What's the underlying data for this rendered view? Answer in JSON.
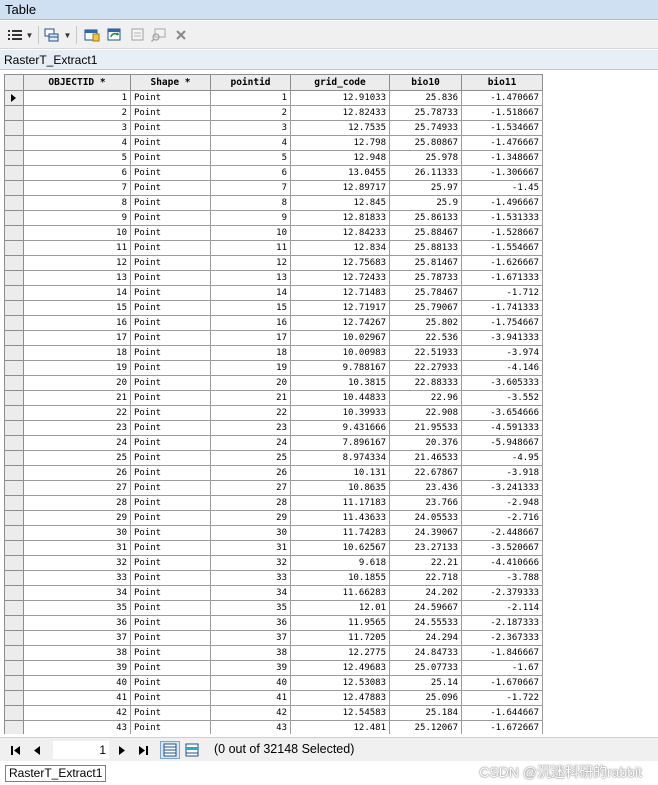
{
  "window": {
    "title": "Table"
  },
  "table_tab": "RasterT_Extract1",
  "columns": [
    "OBJECTID *",
    "Shape *",
    "pointid",
    "grid_code",
    "bio10",
    "bio11"
  ],
  "rows": [
    [
      "1",
      "Point",
      "1",
      "12.91033",
      "25.836",
      "-1.470667"
    ],
    [
      "2",
      "Point",
      "2",
      "12.82433",
      "25.78733",
      "-1.518667"
    ],
    [
      "3",
      "Point",
      "3",
      "12.7535",
      "25.74933",
      "-1.534667"
    ],
    [
      "4",
      "Point",
      "4",
      "12.798",
      "25.80867",
      "-1.476667"
    ],
    [
      "5",
      "Point",
      "5",
      "12.948",
      "25.978",
      "-1.348667"
    ],
    [
      "6",
      "Point",
      "6",
      "13.0455",
      "26.11333",
      "-1.306667"
    ],
    [
      "7",
      "Point",
      "7",
      "12.89717",
      "25.97",
      "-1.45"
    ],
    [
      "8",
      "Point",
      "8",
      "12.845",
      "25.9",
      "-1.496667"
    ],
    [
      "9",
      "Point",
      "9",
      "12.81833",
      "25.86133",
      "-1.531333"
    ],
    [
      "10",
      "Point",
      "10",
      "12.84233",
      "25.88467",
      "-1.528667"
    ],
    [
      "11",
      "Point",
      "11",
      "12.834",
      "25.88133",
      "-1.554667"
    ],
    [
      "12",
      "Point",
      "12",
      "12.75683",
      "25.81467",
      "-1.626667"
    ],
    [
      "13",
      "Point",
      "13",
      "12.72433",
      "25.78733",
      "-1.671333"
    ],
    [
      "14",
      "Point",
      "14",
      "12.71483",
      "25.78467",
      "-1.712"
    ],
    [
      "15",
      "Point",
      "15",
      "12.71917",
      "25.79067",
      "-1.741333"
    ],
    [
      "16",
      "Point",
      "16",
      "12.74267",
      "25.802",
      "-1.754667"
    ],
    [
      "17",
      "Point",
      "17",
      "10.02967",
      "22.536",
      "-3.941333"
    ],
    [
      "18",
      "Point",
      "18",
      "10.00983",
      "22.51933",
      "-3.974"
    ],
    [
      "19",
      "Point",
      "19",
      "9.788167",
      "22.27933",
      "-4.146"
    ],
    [
      "20",
      "Point",
      "20",
      "10.3815",
      "22.88333",
      "-3.605333"
    ],
    [
      "21",
      "Point",
      "21",
      "10.44833",
      "22.96",
      "-3.552"
    ],
    [
      "22",
      "Point",
      "22",
      "10.39933",
      "22.908",
      "-3.654666"
    ],
    [
      "23",
      "Point",
      "23",
      "9.431666",
      "21.95533",
      "-4.591333"
    ],
    [
      "24",
      "Point",
      "24",
      "7.896167",
      "20.376",
      "-5.948667"
    ],
    [
      "25",
      "Point",
      "25",
      "8.974334",
      "21.46533",
      "-4.95"
    ],
    [
      "26",
      "Point",
      "26",
      "10.131",
      "22.67867",
      "-3.918"
    ],
    [
      "27",
      "Point",
      "27",
      "10.8635",
      "23.436",
      "-3.241333"
    ],
    [
      "28",
      "Point",
      "28",
      "11.17183",
      "23.766",
      "-2.948"
    ],
    [
      "29",
      "Point",
      "29",
      "11.43633",
      "24.05533",
      "-2.716"
    ],
    [
      "30",
      "Point",
      "30",
      "11.74283",
      "24.39067",
      "-2.448667"
    ],
    [
      "31",
      "Point",
      "31",
      "10.62567",
      "23.27133",
      "-3.520667"
    ],
    [
      "32",
      "Point",
      "32",
      "9.618",
      "22.21",
      "-4.410666"
    ],
    [
      "33",
      "Point",
      "33",
      "10.1855",
      "22.718",
      "-3.788"
    ],
    [
      "34",
      "Point",
      "34",
      "11.66283",
      "24.202",
      "-2.379333"
    ],
    [
      "35",
      "Point",
      "35",
      "12.01",
      "24.59667",
      "-2.114"
    ],
    [
      "36",
      "Point",
      "36",
      "11.9565",
      "24.55533",
      "-2.187333"
    ],
    [
      "37",
      "Point",
      "37",
      "11.7205",
      "24.294",
      "-2.367333"
    ],
    [
      "38",
      "Point",
      "38",
      "12.2775",
      "24.84733",
      "-1.846667"
    ],
    [
      "39",
      "Point",
      "39",
      "12.49683",
      "25.07733",
      "-1.67"
    ],
    [
      "40",
      "Point",
      "40",
      "12.53083",
      "25.14",
      "-1.670667"
    ],
    [
      "41",
      "Point",
      "41",
      "12.47883",
      "25.096",
      "-1.722"
    ],
    [
      "42",
      "Point",
      "42",
      "12.54583",
      "25.184",
      "-1.644667"
    ],
    [
      "43",
      "Point",
      "43",
      "12.481",
      "25.12067",
      "-1.672667"
    ]
  ],
  "navigation": {
    "current_page": "1",
    "status": "(0 out of 32148 Selected)"
  },
  "bottom_tab": "RasterT_Extract1",
  "watermark": "CSDN @沉迷科研的rabbit"
}
